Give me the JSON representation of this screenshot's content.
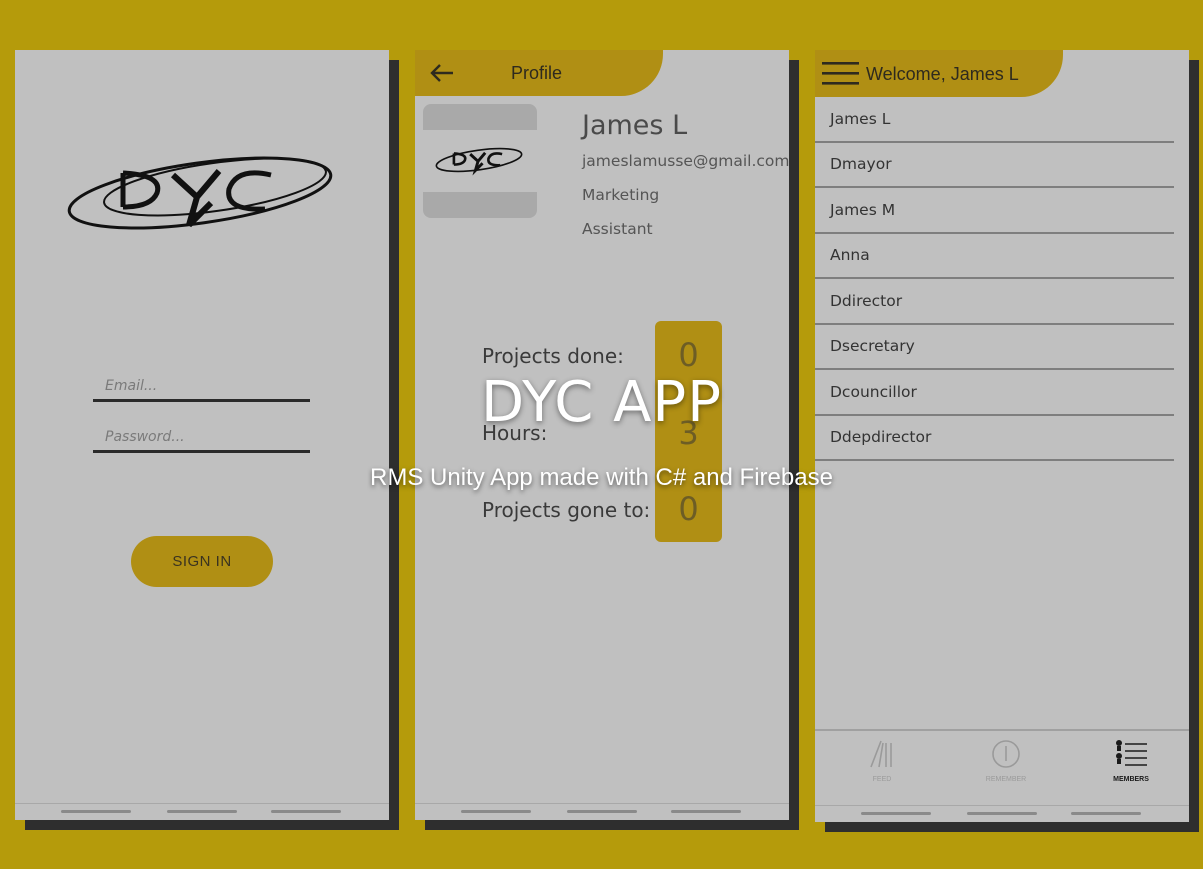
{
  "login": {
    "email_placeholder": "Email...",
    "password_placeholder": "Password...",
    "signin_label": "SIGN IN"
  },
  "profile": {
    "title": "Profile",
    "name": "James L",
    "email": "jameslamusse@gmail.com",
    "department": "Marketing",
    "role": "Assistant",
    "stats": [
      {
        "label": "Projects done:",
        "value": "0"
      },
      {
        "label": "Hours:",
        "value": "3"
      },
      {
        "label": "Projects gone to:",
        "value": "0"
      }
    ]
  },
  "members": {
    "title": "Welcome, James L",
    "list": [
      "James L",
      "Dmayor",
      "James M",
      "Anna",
      "Ddirector",
      "Dsecretary",
      "Dcouncillor",
      "Ddepdirector"
    ],
    "nav": [
      {
        "label": "FEED",
        "icon": "feed-icon"
      },
      {
        "label": "REMEMBER",
        "icon": "info-icon"
      },
      {
        "label": "MEMBERS",
        "icon": "members-icon"
      }
    ]
  },
  "overlay": {
    "title": "DYC APP",
    "subtitle": "RMS Unity App made with C# and Firebase"
  },
  "colors": {
    "background": "#b59b0b",
    "accent": "#b08f14",
    "screen": "#c0c0c0"
  }
}
